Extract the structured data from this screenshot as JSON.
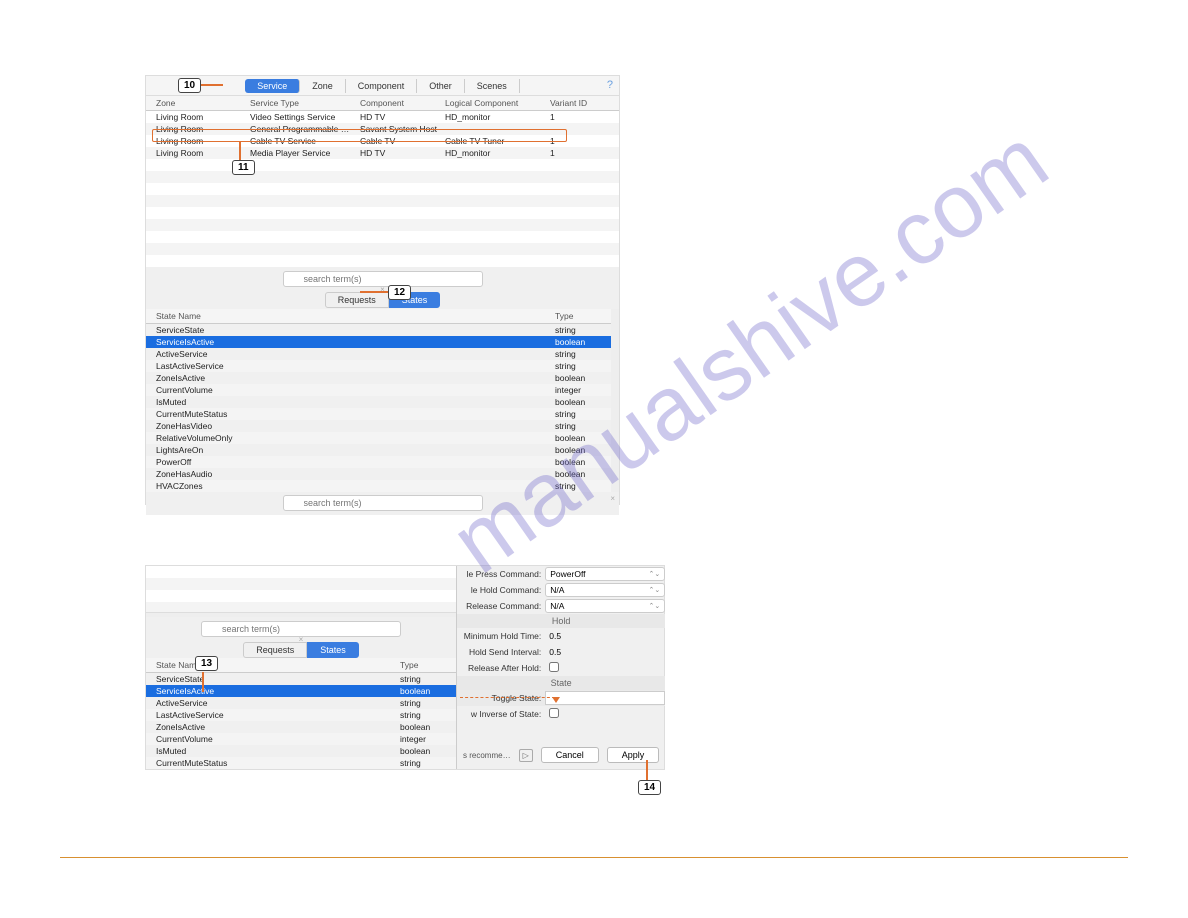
{
  "watermark": "manualshive.com",
  "callouts": {
    "c10": "10",
    "c11": "11",
    "c12": "12",
    "c13": "13",
    "c14": "14"
  },
  "panel1": {
    "tabs": [
      "Service",
      "Zone",
      "Component",
      "Other",
      "Scenes"
    ],
    "activeTab": 0,
    "helpGlyph": "?",
    "columns": {
      "zone": "Zone",
      "serviceType": "Service Type",
      "component": "Component",
      "logicalComponent": "Logical Component",
      "variantId": "Variant ID"
    },
    "rows": [
      {
        "zone": "Living Room",
        "svc": "Video Settings Service",
        "comp": "HD TV",
        "logcomp": "HD_monitor",
        "var": "1"
      },
      {
        "zone": "Living Room",
        "svc": "General Programmable Se…",
        "comp": "Savant System Host",
        "logcomp": "",
        "var": ""
      },
      {
        "zone": "Living Room",
        "svc": "Cable TV Service",
        "comp": "Cable TV",
        "logcomp": "Cable TV Tuner",
        "var": "1"
      },
      {
        "zone": "Living Room",
        "svc": "Media Player Service",
        "comp": "HD TV",
        "logcomp": "HD_monitor",
        "var": "1"
      }
    ],
    "searchPlaceholder": "search term(s)",
    "subTabs": [
      "Requests",
      "States"
    ],
    "activeSubTab": 1,
    "stateColumns": {
      "name": "State Name",
      "type": "Type"
    },
    "states": [
      {
        "name": "ServiceState",
        "type": "string"
      },
      {
        "name": "ServiceIsActive",
        "type": "boolean",
        "selected": true
      },
      {
        "name": "ActiveService",
        "type": "string"
      },
      {
        "name": "LastActiveService",
        "type": "string"
      },
      {
        "name": "ZoneIsActive",
        "type": "boolean"
      },
      {
        "name": "CurrentVolume",
        "type": "integer"
      },
      {
        "name": "IsMuted",
        "type": "boolean"
      },
      {
        "name": "CurrentMuteStatus",
        "type": "string"
      },
      {
        "name": "ZoneHasVideo",
        "type": "string"
      },
      {
        "name": "RelativeVolumeOnly",
        "type": "boolean"
      },
      {
        "name": "LightsAreOn",
        "type": "boolean"
      },
      {
        "name": "PowerOff",
        "type": "boolean"
      },
      {
        "name": "ZoneHasAudio",
        "type": "boolean"
      },
      {
        "name": "HVACZones",
        "type": "string"
      }
    ]
  },
  "panel2": {
    "searchPlaceholder": "search term(s)",
    "subTabs": [
      "Requests",
      "States"
    ],
    "activeSubTab": 1,
    "stateColumns": {
      "name": "State Name",
      "type": "Type"
    },
    "states": [
      {
        "name": "ServiceState",
        "type": "string"
      },
      {
        "name": "ServiceIsActive",
        "type": "boolean",
        "selected": true
      },
      {
        "name": "ActiveService",
        "type": "string"
      },
      {
        "name": "LastActiveService",
        "type": "string"
      },
      {
        "name": "ZoneIsActive",
        "type": "boolean"
      },
      {
        "name": "CurrentVolume",
        "type": "integer"
      },
      {
        "name": "IsMuted",
        "type": "boolean"
      },
      {
        "name": "CurrentMuteStatus",
        "type": "string"
      }
    ],
    "form": {
      "pressCommandLabel": "le Press Command:",
      "pressCommandValue": "PowerOff",
      "holdCommandLabel": "le Hold Command:",
      "holdCommandValue": "N/A",
      "releaseCommandLabel": "Release Command:",
      "releaseCommandValue": "N/A",
      "holdHeader": "Hold",
      "minHoldLabel": "Minimum Hold Time:",
      "minHoldValue": "0.5",
      "sendIntervalLabel": "Hold Send Interval:",
      "sendIntervalValue": "0.5",
      "releaseAfterLabel": "Release After Hold:",
      "stateHeader": "State",
      "toggleStateLabel": "Toggle State:",
      "inverseLabel": "w Inverse of State:"
    },
    "buttons": {
      "recomme": "s recomme…",
      "cancel": "Cancel",
      "apply": "Apply"
    }
  }
}
